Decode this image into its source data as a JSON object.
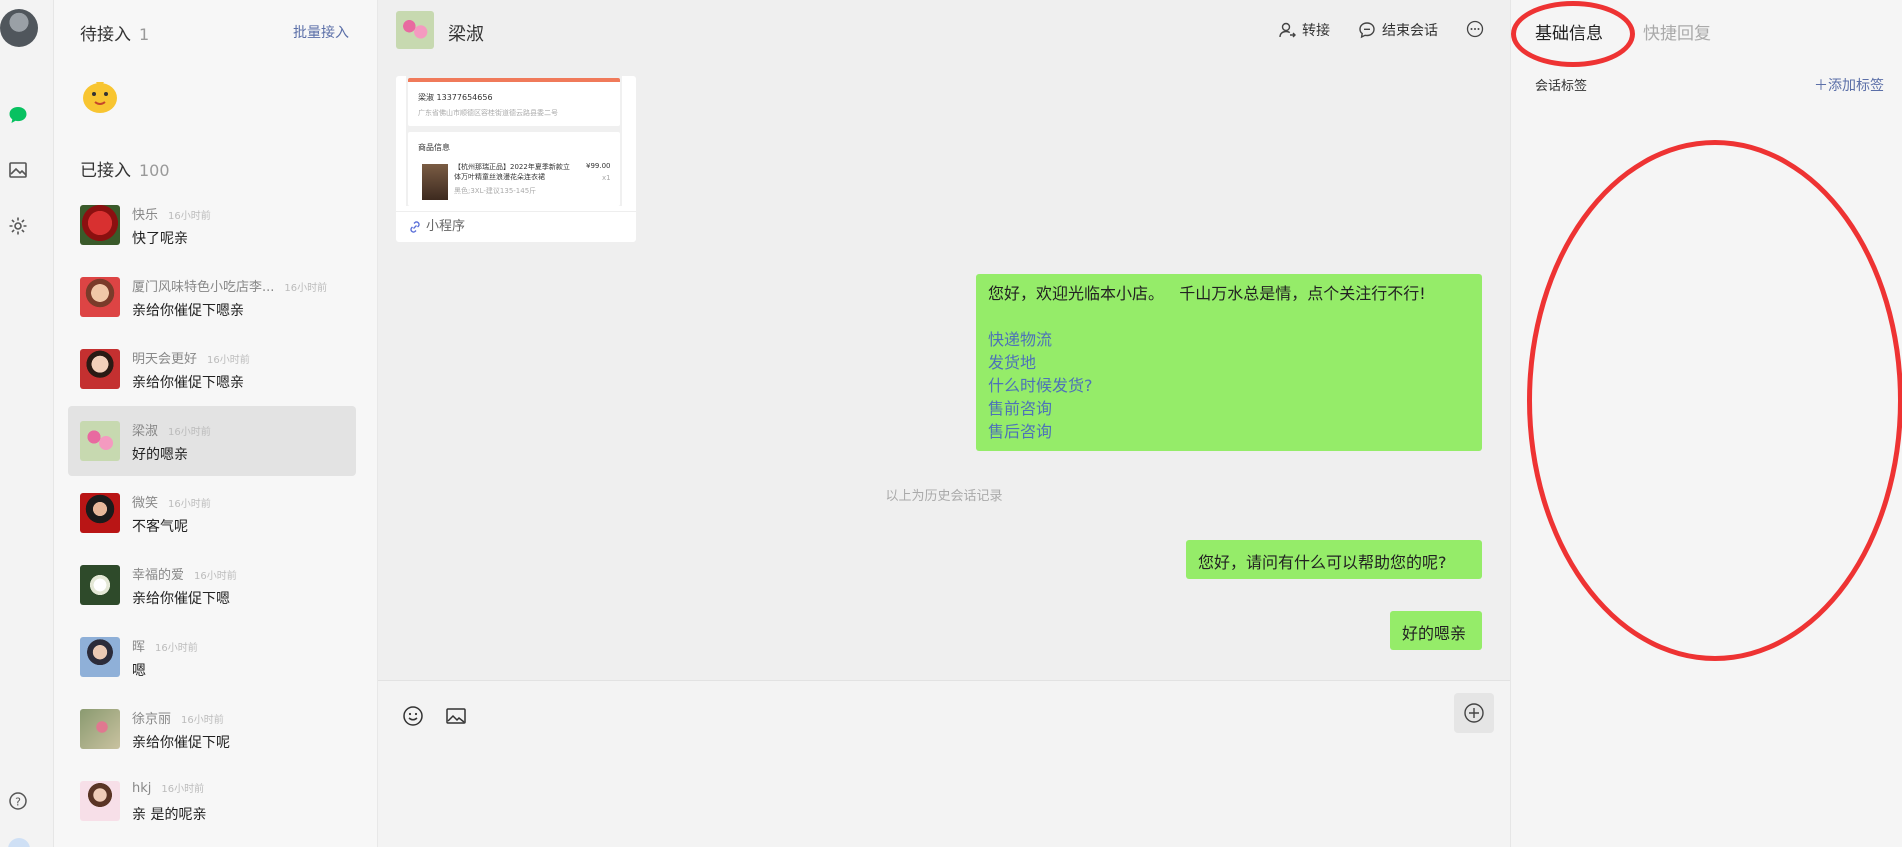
{
  "rail": {
    "icons": [
      "user-avatar",
      "chat-bubble-icon",
      "image-gallery-icon",
      "gear-icon",
      "help-icon"
    ],
    "active_color": "#07c160"
  },
  "list": {
    "pending_title": "待接入",
    "pending_count": "1",
    "batch_label": "批量接入",
    "accepted_title": "已接入",
    "accepted_count": "100",
    "conversations": [
      {
        "name": "快乐",
        "time": "16小时前",
        "message": "快了呢亲"
      },
      {
        "name": "厦门风味特色小吃店李...",
        "time": "16小时前",
        "message": "亲给你催促下嗯亲"
      },
      {
        "name": "明天会更好",
        "time": "16小时前",
        "message": "亲给你催促下嗯亲"
      },
      {
        "name": "梁淑",
        "time": "16小时前",
        "message": "好的嗯亲"
      },
      {
        "name": "微笑",
        "time": "16小时前",
        "message": "不客气呢"
      },
      {
        "name": "幸福的爱",
        "time": "16小时前",
        "message": "亲给你催促下嗯"
      },
      {
        "name": "晖",
        "time": "16小时前",
        "message": "嗯"
      },
      {
        "name": "徐京丽",
        "time": "16小时前",
        "message": "亲给你催促下呢"
      },
      {
        "name": "hkj",
        "time": "16小时前",
        "message": "亲 是的呢亲"
      }
    ]
  },
  "chat": {
    "contact_name": "梁淑",
    "transfer_label": "转接",
    "end_label": "结束会话",
    "card": {
      "addr_line1": "梁淑 13377654656",
      "addr_line2": "广东省佛山市顺德区容桂街道德云路县委二号",
      "goods_title": "商品信息",
      "goods_desc": "【杭州那瑞正品】2022年夏季新款立体万叶精童丝浪漫花朵连衣裙",
      "goods_spec": "黑色;3XL-建议135-145斤",
      "goods_price": "¥99.00",
      "goods_qty": "x1",
      "footer": "小程序"
    },
    "welcome_text": "您好，欢迎光临本小店。   千山万水总是情，点个关注行不行!",
    "quick_links": [
      "快递物流",
      "发货地",
      "什么时候发货?",
      "售前咨询",
      "售后咨询"
    ],
    "history_divider": "以上为历史会话记录",
    "greeting": "您好，请问有什么可以帮助您的呢?",
    "reply": "好的嗯亲",
    "bubble_color": "#95ec69"
  },
  "side": {
    "tab_basic": "基础信息",
    "tab_quick": "快捷回复",
    "tag_label": "会话标签",
    "add_tag": "添加标签",
    "annotation_color": "#ee3333"
  }
}
